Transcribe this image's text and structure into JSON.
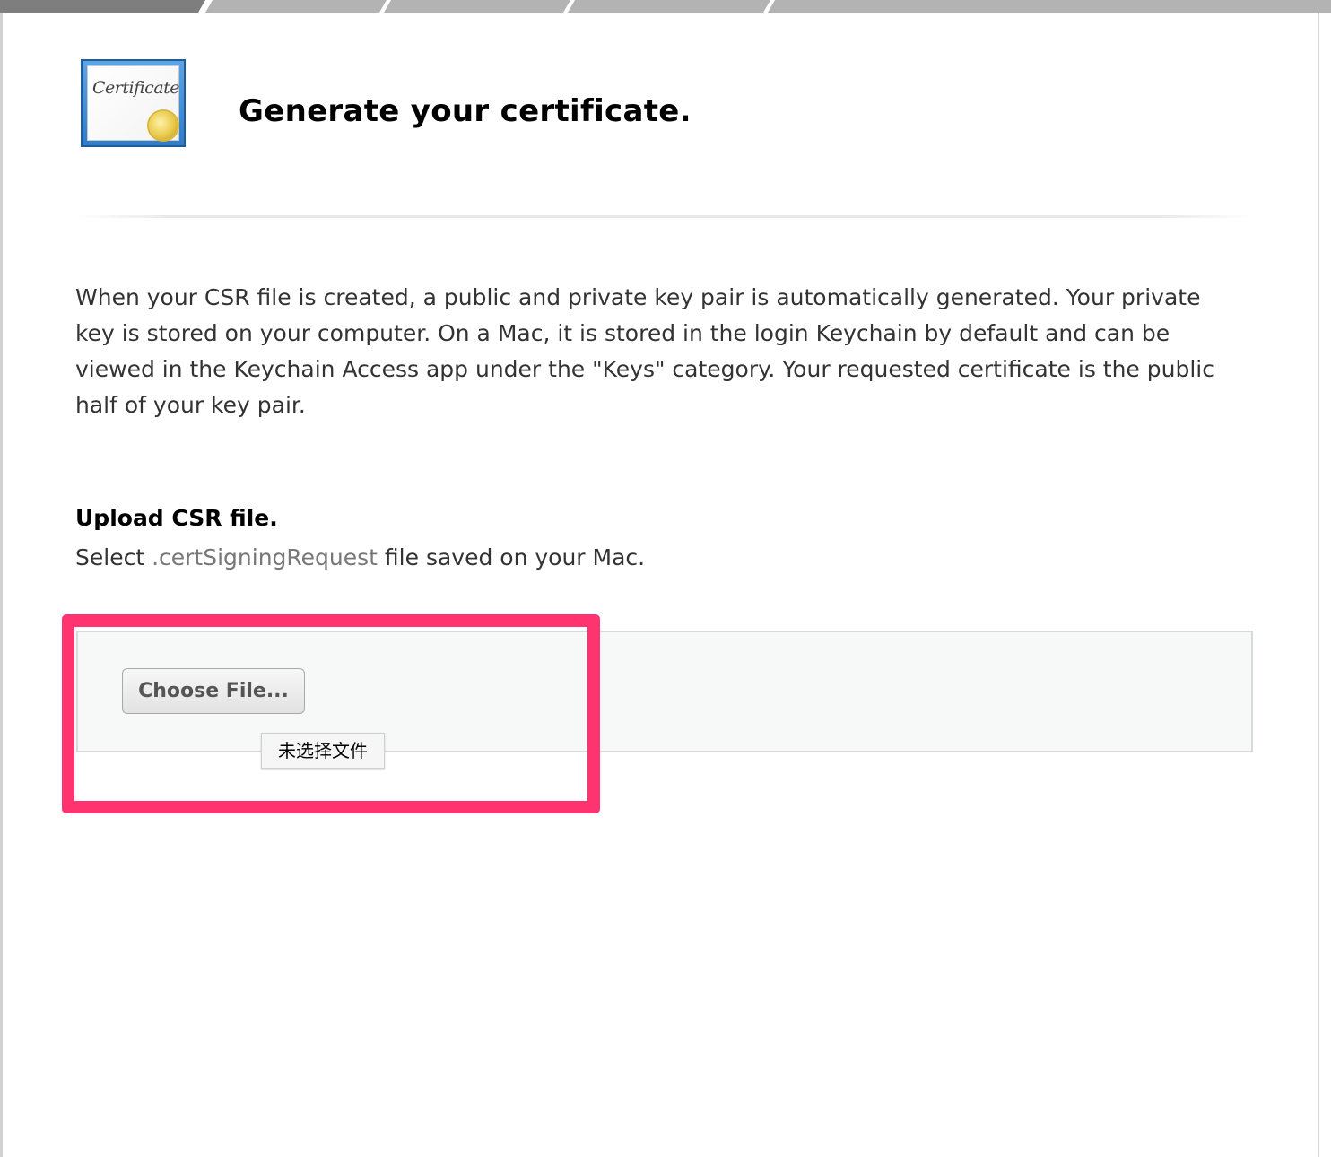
{
  "steps": [
    "step-1",
    "step-2",
    "step-3",
    "step-4",
    "step-5"
  ],
  "header": {
    "icon": "certificate-icon",
    "icon_text": "Certificate",
    "title": "Generate your certificate."
  },
  "intro": {
    "text": "When your CSR file is created, a public and private key pair is automatically generated. Your private key is stored on your computer. On a Mac, it is stored in the login Keychain by default and can be viewed in the Keychain Access app under the \"Keys\" category. Your requested certificate is the public half of your key pair."
  },
  "upload": {
    "heading": "Upload CSR file.",
    "desc_prefix": "Select ",
    "desc_ext": ".certSigningRequest",
    "desc_suffix": " file saved on your Mac.",
    "button_label": "Choose File...",
    "no_file_label": "未选择文件"
  },
  "colors": {
    "highlight": "#ff3370",
    "active_step": "#7e7e7e",
    "inactive_step": "#b3b3b3",
    "icon_frame": "#2f7ccb"
  }
}
